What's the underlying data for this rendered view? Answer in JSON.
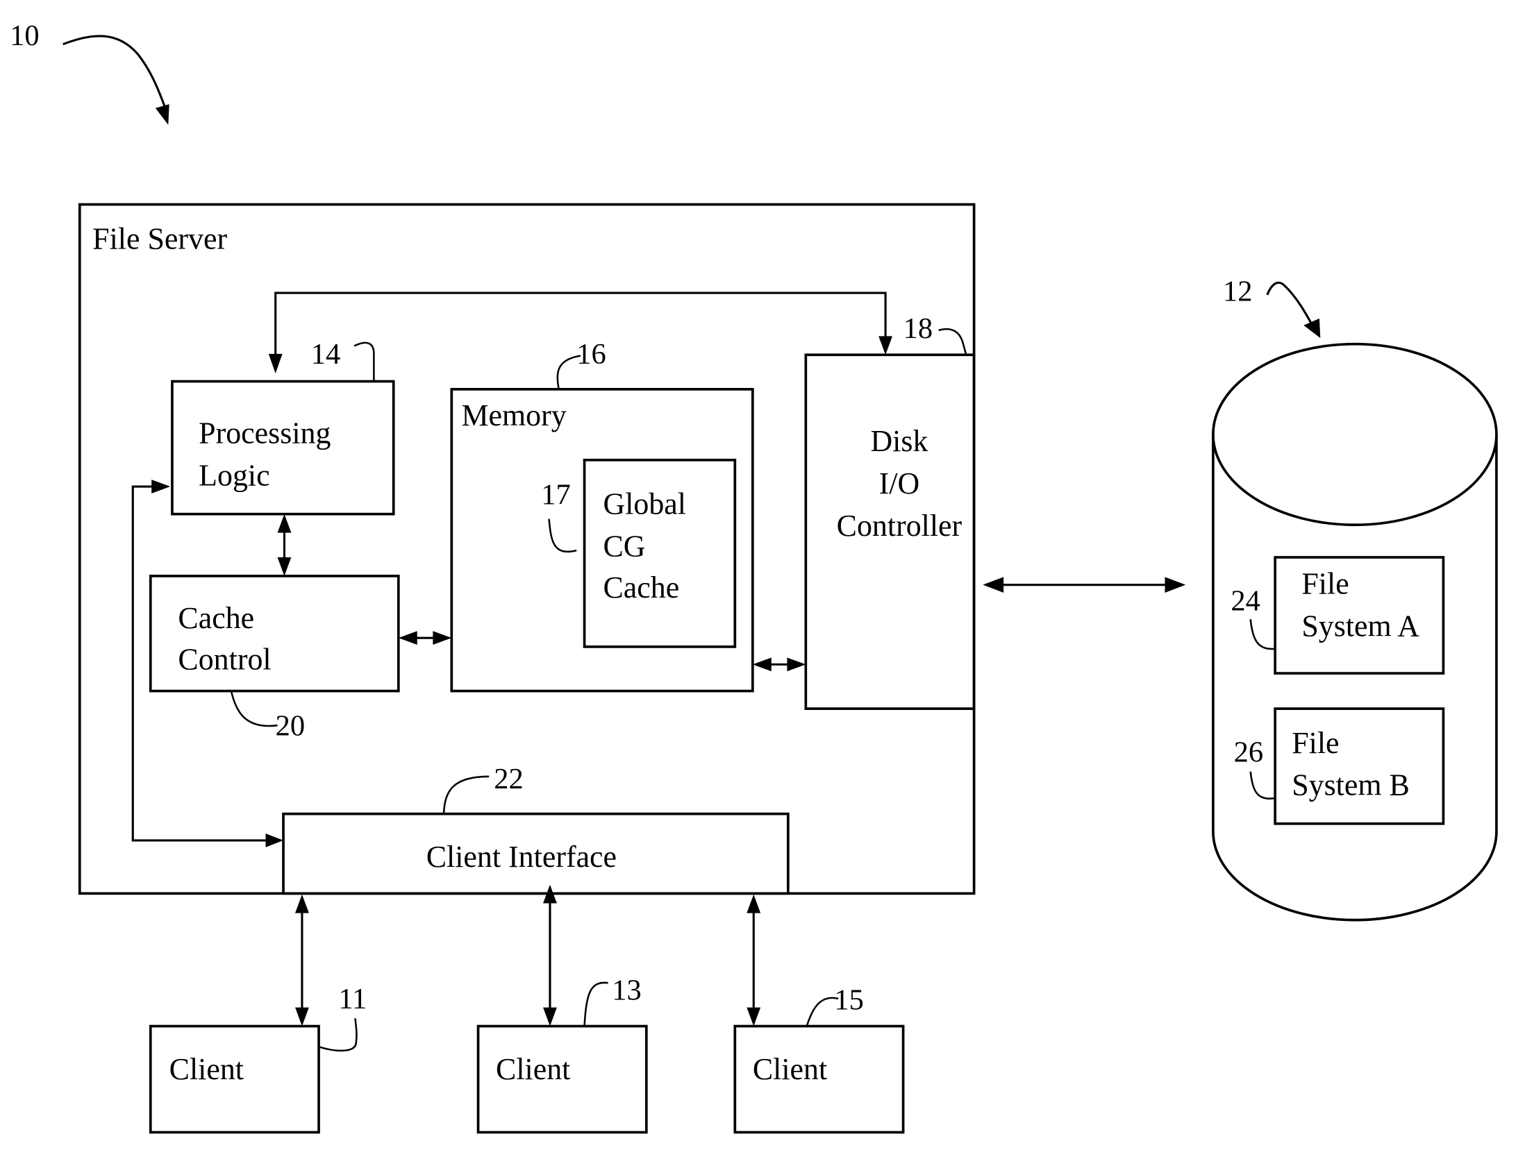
{
  "figure": {
    "ref": "10",
    "file_server": {
      "title": "File Server"
    },
    "components": {
      "processing_logic": {
        "ref": "14",
        "lines": [
          "Processing",
          "Logic"
        ]
      },
      "memory": {
        "ref": "16",
        "title": "Memory"
      },
      "global_cg_cache": {
        "ref": "17",
        "lines": [
          "Global",
          "CG",
          "Cache"
        ]
      },
      "disk_io_controller": {
        "ref": "18",
        "lines": [
          "Disk",
          "I/O",
          "Controller"
        ]
      },
      "cache_control": {
        "ref": "20",
        "lines": [
          "Cache",
          "Control"
        ]
      },
      "client_interface": {
        "ref": "22",
        "label": "Client Interface"
      }
    },
    "clients": [
      {
        "ref": "11",
        "label": "Client"
      },
      {
        "ref": "13",
        "label": "Client"
      },
      {
        "ref": "15",
        "label": "Client"
      }
    ],
    "storage": {
      "ref": "12",
      "file_systems": [
        {
          "ref": "24",
          "lines": [
            "File",
            "System A"
          ]
        },
        {
          "ref": "26",
          "lines": [
            "File",
            "System B"
          ]
        }
      ]
    }
  }
}
